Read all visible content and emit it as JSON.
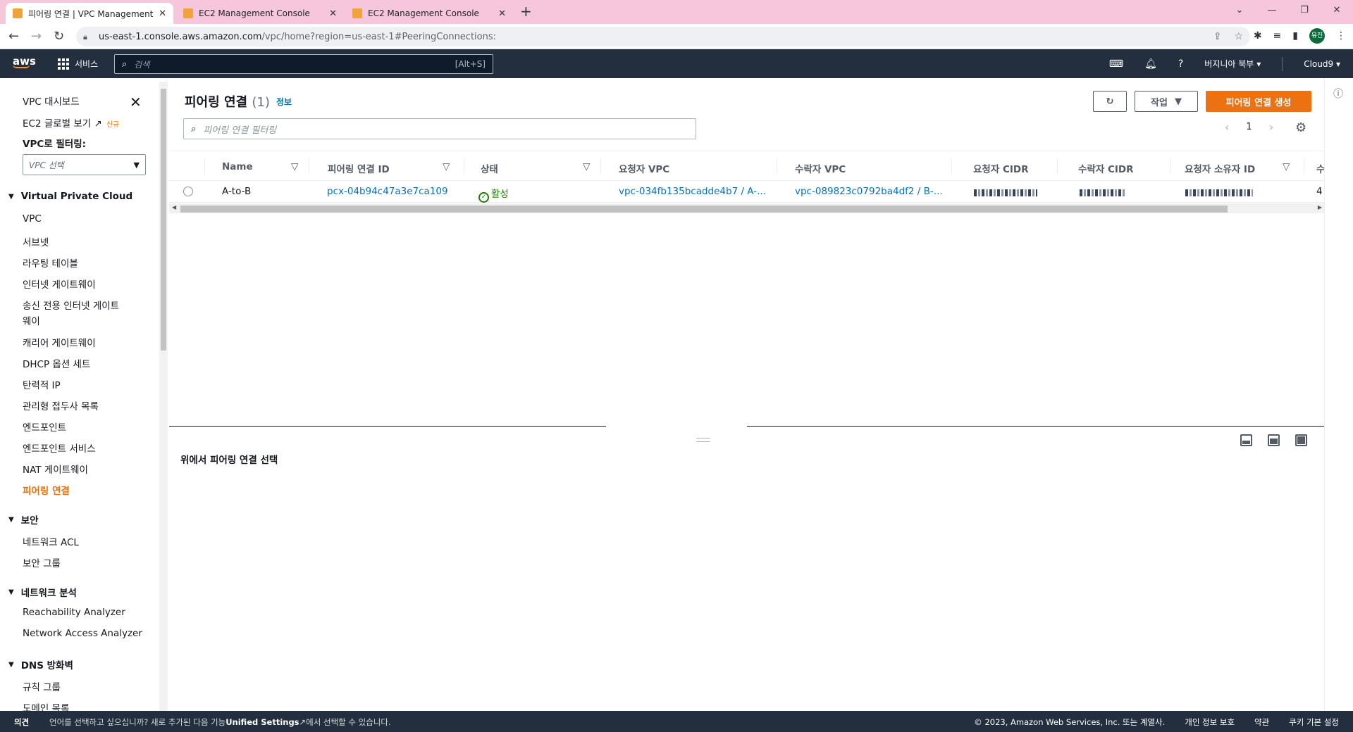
{
  "browser": {
    "tabs": [
      {
        "title": "피어링 연결 | VPC Management",
        "active": true
      },
      {
        "title": "EC2 Management Console",
        "active": false
      },
      {
        "title": "EC2 Management Console",
        "active": false
      }
    ],
    "url_host": "us-east-1.console.aws.amazon.com",
    "url_path": "/vpc/home?region=us-east-1#PeeringConnections:",
    "profile_initials": "유진"
  },
  "awsnav": {
    "logo": "aws",
    "services_label": "서비스",
    "search_placeholder": "검색",
    "search_shortcut": "[Alt+S]",
    "region": "버지니아 북부",
    "account": "Cloud9"
  },
  "sidebar": {
    "dashboard": "VPC 대시보드",
    "ec2_global": "EC2 글로벌 보기",
    "new_badge": "신규",
    "filter_label": "VPC로 필터링:",
    "vpc_select_placeholder": "VPC 선택",
    "sections": {
      "vpc": "Virtual Private Cloud",
      "security": "보안",
      "network_analysis": "네트워크 분석",
      "dns_firewall": "DNS 방화벽"
    },
    "vpc_items": [
      "VPC",
      "서브넷",
      "라우팅 테이블",
      "인터넷 게이트웨이",
      "송신 전용 인터넷 게이트",
      "웨이",
      "캐리어 게이트웨이",
      "DHCP 옵션 세트",
      "탄력적 IP",
      "관리형 접두사 목록",
      "엔드포인트",
      "엔드포인트 서비스",
      "NAT 게이트웨이",
      "피어링 연결"
    ],
    "security_items": [
      "네트워크 ACL",
      "보안 그룹"
    ],
    "analysis_items": [
      "Reachability Analyzer",
      "Network Access Analyzer"
    ],
    "dns_items": [
      "규칙 그룹",
      "도메인 목록"
    ]
  },
  "main": {
    "title": "피어링 연결",
    "count": "(1)",
    "info": "정보",
    "actions_label": "작업",
    "create_label": "피어링 연결 생성",
    "filter_placeholder": "피어링 연결 필터링",
    "page": "1",
    "columns": [
      "Name",
      "피어링 연결 ID",
      "상태",
      "요청자 VPC",
      "수락자 VPC",
      "요청자 CIDR",
      "수락자 CIDR",
      "요청자 소유자 ID",
      "수"
    ],
    "rows": [
      {
        "name": "A-to-B",
        "id": "pcx-04b94c47a3e7ca109",
        "status": "활성",
        "requester_vpc": "vpc-034fb135bcadde4b7 / A-...",
        "accepter_vpc": "vpc-089823c0792ba4df2 / B-...",
        "last_col": "4"
      }
    ],
    "detail_prompt": "위에서 피어링 연결 선택"
  },
  "footer": {
    "feedback": "의견",
    "msg_prefix": "언어를 선택하고 싶으십니까? 새로 추가된 다음 기능",
    "msg_link": "Unified Settings",
    "msg_suffix": "에서 선택할 수 있습니다.",
    "copyright": "© 2023, Amazon Web Services, Inc. 또는 계열사.",
    "privacy": "개인 정보 보호",
    "terms": "약관",
    "cookies": "쿠키 기본 설정"
  },
  "colors": {
    "accent": "#ec7211",
    "link": "#0073bb",
    "nav_bg": "#232f3e",
    "status_ok": "#1d8102"
  }
}
